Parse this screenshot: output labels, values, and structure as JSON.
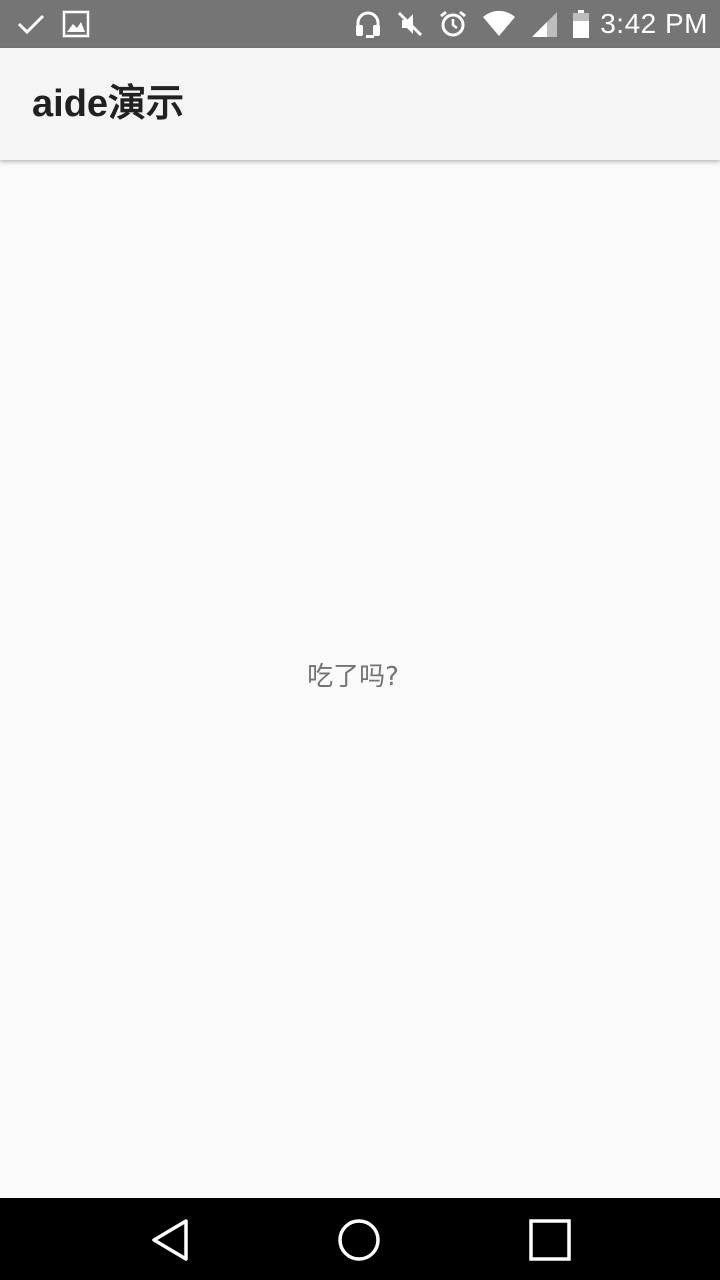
{
  "status_bar": {
    "time": "3:42 PM",
    "left_icons": [
      "check-icon",
      "image-icon"
    ],
    "right_icons": [
      "headphones-icon",
      "vibrate-off-icon",
      "alarm-icon",
      "wifi-icon",
      "signal-icon",
      "battery-icon"
    ]
  },
  "app_bar": {
    "title": "aide演示"
  },
  "content": {
    "message": "吃了吗?"
  },
  "nav_bar": {
    "buttons": [
      "back",
      "home",
      "recents"
    ]
  },
  "colors": {
    "status_bar_bg": "#757575",
    "app_bar_bg": "#f5f5f5",
    "content_bg": "#fafafa",
    "nav_bar_bg": "#000000",
    "title_text": "#212121",
    "body_text": "#737373"
  }
}
